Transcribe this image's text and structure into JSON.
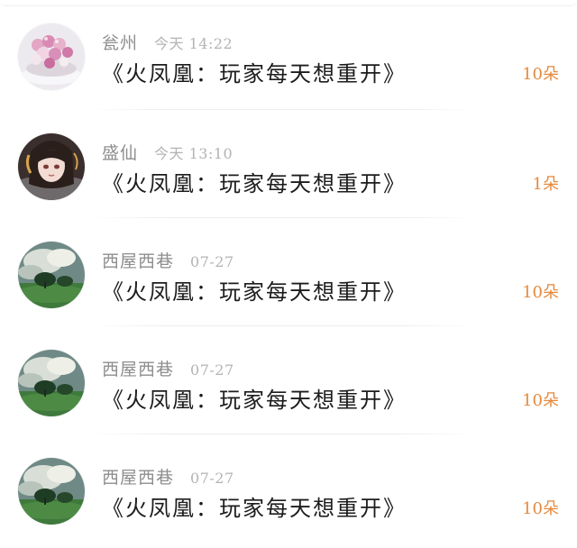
{
  "comments": [
    {
      "name": "瓮州",
      "time": "今天 14:22",
      "title": "《火凤凰：玩家每天想重开》",
      "count": "10朵",
      "avatar_icon": "dessert-avatar-icon"
    },
    {
      "name": "盛仙",
      "time": "今天 13:10",
      "title": "《火凤凰：玩家每天想重开》",
      "count": "1朵",
      "avatar_icon": "anime-girl-avatar-icon"
    },
    {
      "name": "西屋西巷",
      "time": "07-27",
      "title": "《火凤凰：玩家每天想重开》",
      "count": "10朵",
      "avatar_icon": "landscape-avatar-icon"
    },
    {
      "name": "西屋西巷",
      "time": "07-27",
      "title": "《火凤凰：玩家每天想重开》",
      "count": "10朵",
      "avatar_icon": "landscape-avatar-icon"
    },
    {
      "name": "西屋西巷",
      "time": "07-27",
      "title": "《火凤凰：玩家每天想重开》",
      "count": "10朵",
      "avatar_icon": "landscape-avatar-icon"
    }
  ],
  "colors": {
    "name": "#8e8e8e",
    "time": "#b3b3b3",
    "title": "#1c1c1c",
    "count_accent": "#e58a3c",
    "divider": "#ececec"
  }
}
